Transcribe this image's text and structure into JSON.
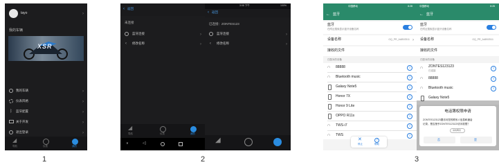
{
  "labels": {
    "s1": "1",
    "s2": "2",
    "s3": "3"
  },
  "screen1": {
    "username": "tayo",
    "section_title": "我的车辆",
    "banner_text": "XSR",
    "menu": [
      {
        "icon": "bike-icon",
        "label": "我的车辆"
      },
      {
        "icon": "gear-icon",
        "label": "仪表风格"
      },
      {
        "icon": "bluetooth-icon",
        "label": "蓝牙配置"
      },
      {
        "icon": "info-icon",
        "label": "关于开发"
      },
      {
        "icon": "logout-icon",
        "label": "退出登录"
      }
    ],
    "tabs": [
      "导航",
      "仪表",
      "我的"
    ]
  },
  "screen2a": {
    "back_label": "返回",
    "status": "未连接",
    "items": [
      {
        "icon": "bluetooth-icon",
        "label": "蓝牙连接"
      },
      {
        "icon": "edit-icon",
        "label": "修改名称"
      }
    ],
    "tabs": [
      "导航",
      "仪表",
      "我的"
    ]
  },
  "screen2b": {
    "status_time": "3:08 下午",
    "status_pct": "100%",
    "back_label": "返回",
    "status": "已连接：ZONTES123",
    "items": [
      {
        "icon": "bluetooth-icon",
        "label": "蓝牙连接"
      },
      {
        "icon": "edit-icon",
        "label": "修改名称"
      }
    ]
  },
  "screen3a": {
    "status_left": "中国移动",
    "status_right": "8:28",
    "title": "蓝牙",
    "bt_label": "蓝牙",
    "bt_sub": "在附近搜索显示蓝牙设备名称",
    "device_name_label": "设备名称",
    "device_name_value": "GQ_PR_AAB92511",
    "received_files": "接收的文件",
    "paired_header": "已配对的设备",
    "devices": [
      {
        "icon": "headset-icon",
        "name": "88888"
      },
      {
        "icon": "headset-icon",
        "name": "Bluetooth music"
      },
      {
        "icon": "phone-icon",
        "name": "Galaxy Note5"
      },
      {
        "icon": "phone-icon",
        "name": "Honor 7X"
      },
      {
        "icon": "phone-icon",
        "name": "Honor 9 Lite"
      },
      {
        "icon": "phone-icon",
        "name": "OPPO R11s"
      },
      {
        "icon": "headset-icon",
        "name": "TWS-i7"
      },
      {
        "icon": "headset-icon",
        "name": "TWS"
      }
    ],
    "bottom_actions": [
      "停止",
      "帮助"
    ]
  },
  "screen3b": {
    "status_left": "中国移动",
    "status_right": "8:28",
    "title": "蓝牙",
    "bt_label": "蓝牙",
    "bt_sub": "在附近搜索显示蓝牙设备名称",
    "device_name_label": "设备名称",
    "device_name_value": "GQ_PR_AAB92511",
    "received_files": "接收的文件",
    "paired_header": "已配对的设备",
    "devices": [
      {
        "icon": "headset-icon",
        "name": "ZONTES123123",
        "sub": "已连接"
      },
      {
        "icon": "headset-icon",
        "name": "88888"
      },
      {
        "icon": "headset-icon",
        "name": "Bluetooth music"
      },
      {
        "icon": "phone-icon",
        "name": "Galaxy Note5"
      }
    ],
    "dialog": {
      "title": "电话簿权限申请",
      "body_line1": "ZONTES123123要访问您的联系人信息和通话",
      "body_line2": "记录，是否授予ZONTES123123访问权限？",
      "pill": "请勿再次",
      "deny": "否",
      "allow": "是"
    }
  }
}
